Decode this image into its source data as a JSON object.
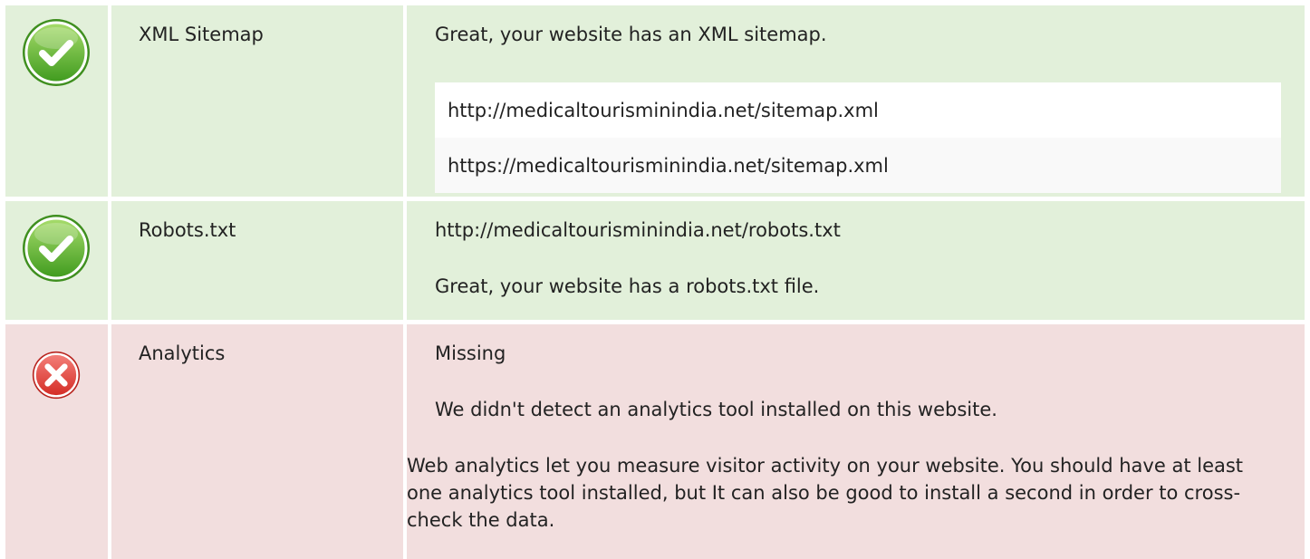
{
  "rows": [
    {
      "status": "pass",
      "icon": "check-circle-icon",
      "label": "XML Sitemap",
      "message": "Great, your website has an XML sitemap.",
      "urls": [
        "http://medicaltourisminindia.net/sitemap.xml",
        "https://medicaltourisminindia.net/sitemap.xml"
      ]
    },
    {
      "status": "pass",
      "icon": "check-circle-icon",
      "label": "Robots.txt",
      "url": "http://medicaltourisminindia.net/robots.txt",
      "message": "Great, your website has a robots.txt file."
    },
    {
      "status": "fail",
      "icon": "error-circle-icon",
      "label": "Analytics",
      "status_text": "Missing",
      "message": "We didn't detect an analytics tool installed on this website.",
      "description": "Web analytics let you measure visitor activity on your website. You should have at least one analytics tool installed, but It can also be good to install a second in order to cross-check the data."
    }
  ],
  "colors": {
    "pass_background": "#e2f0da",
    "fail_background": "#f2dede",
    "pass_icon": "#6cbe3f",
    "fail_icon": "#e0403a"
  }
}
